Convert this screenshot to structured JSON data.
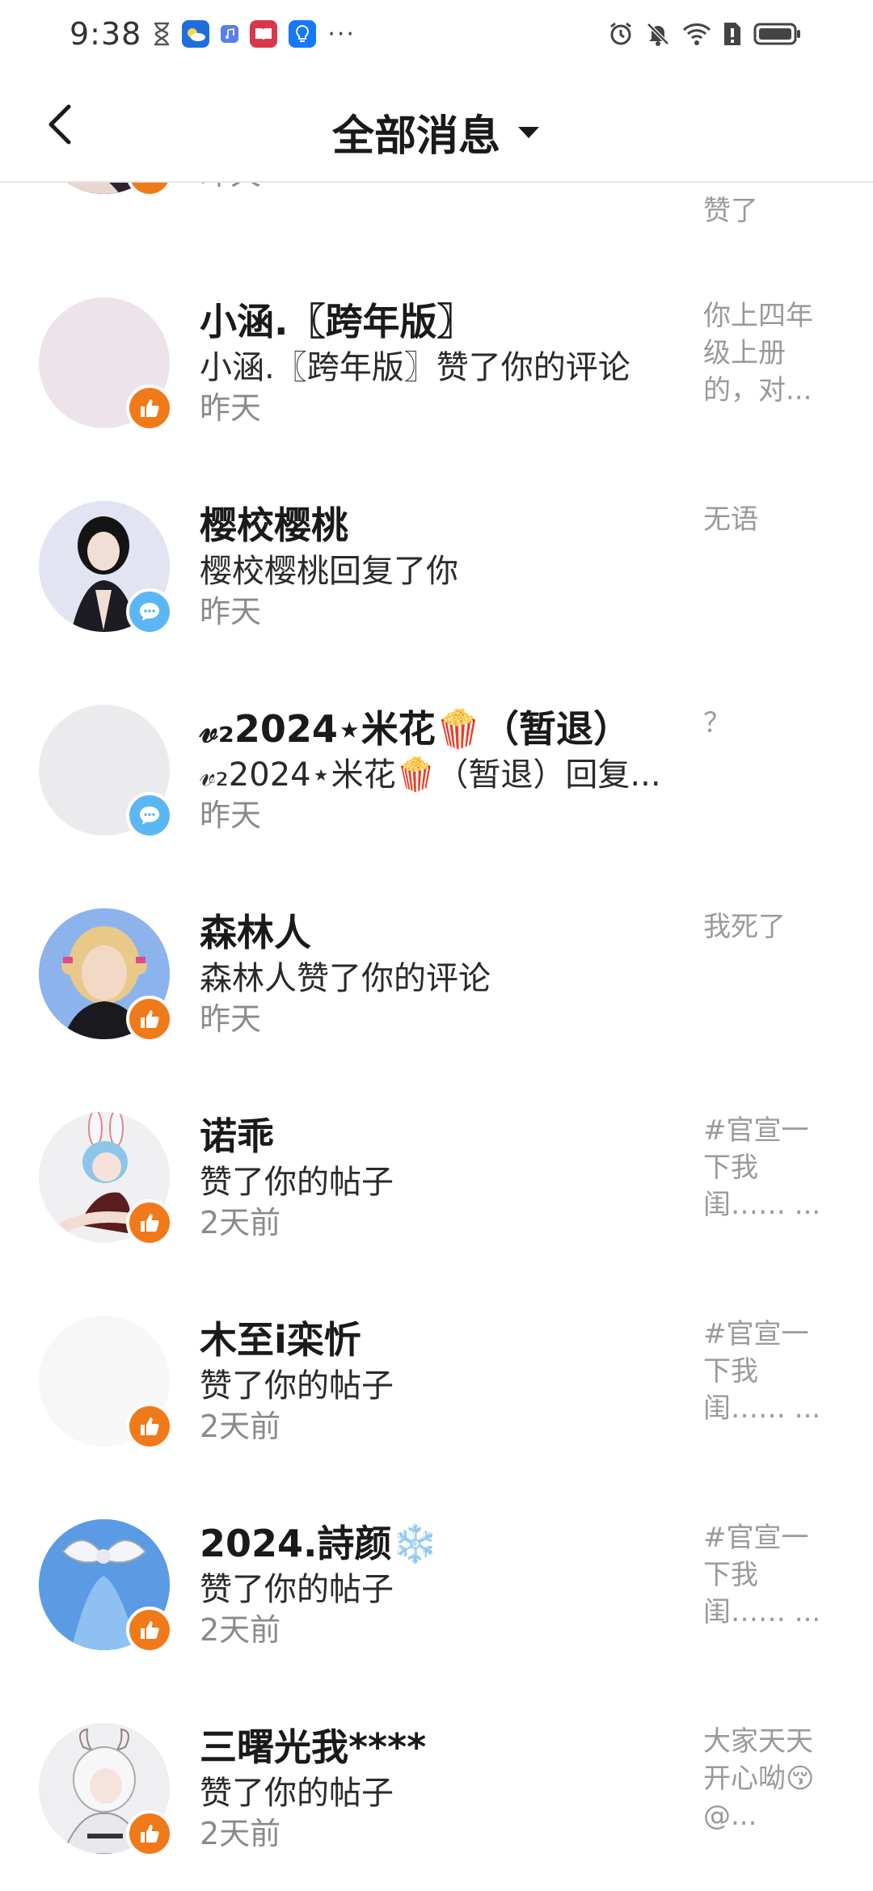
{
  "status_bar": {
    "time": "9:38",
    "left_icons": [
      "hourglass-icon",
      "weather-app-icon",
      "music-app-icon",
      "book-app-icon",
      "bulb-app-icon"
    ],
    "overflow": "···",
    "right_icons": [
      "alarm-icon",
      "mute-icon",
      "wifi-icon",
      "sim-alert-icon",
      "battery-icon"
    ]
  },
  "header": {
    "title": "全部消息",
    "back_icon": "chevron-left-icon",
    "dropdown_icon": "caret-down-icon"
  },
  "colors": {
    "like_badge": "#f07a1a",
    "reply_badge": "#5cb6f3"
  },
  "messages": [
    {
      "name": "",
      "action": "",
      "time": "昨天",
      "snippet": "赞了",
      "badge": "like"
    },
    {
      "name": "小涵.〖跨年版〗",
      "action": "小涵.〖跨年版〗赞了你的评论",
      "time": "昨天",
      "snippet": "你上四年级上册的，对...",
      "badge": "like"
    },
    {
      "name": "樱校樱桃",
      "action": "樱校樱桃回复了你",
      "time": "昨天",
      "snippet": "无语",
      "badge": "reply"
    },
    {
      "name": "𝓋₂2024⋆米花🍿（暂退）",
      "action": "𝓋₂2024⋆米花🍿（暂退）回复...",
      "time": "昨天",
      "snippet": "？",
      "badge": "reply"
    },
    {
      "name": "森林人",
      "action": "森林人赞了你的评论",
      "time": "昨天",
      "snippet": "我死了",
      "badge": "like"
    },
    {
      "name": "诺乖",
      "action": "赞了你的帖子",
      "time": "2天前",
      "snippet": "#官宣一下我闺…… ...",
      "badge": "like"
    },
    {
      "name": "木至i栾忻",
      "action": "赞了你的帖子",
      "time": "2天前",
      "snippet": "#官宣一下我闺…… ...",
      "badge": "like"
    },
    {
      "name": "2024.詩颜❄️",
      "action": "赞了你的帖子",
      "time": "2天前",
      "snippet": "#官宣一下我闺…… ...",
      "badge": "like"
    },
    {
      "name": "三曙光我****",
      "action": "赞了你的帖子",
      "time": "2天前",
      "snippet": "大家天天开心呦😚@...",
      "badge": "like"
    }
  ]
}
